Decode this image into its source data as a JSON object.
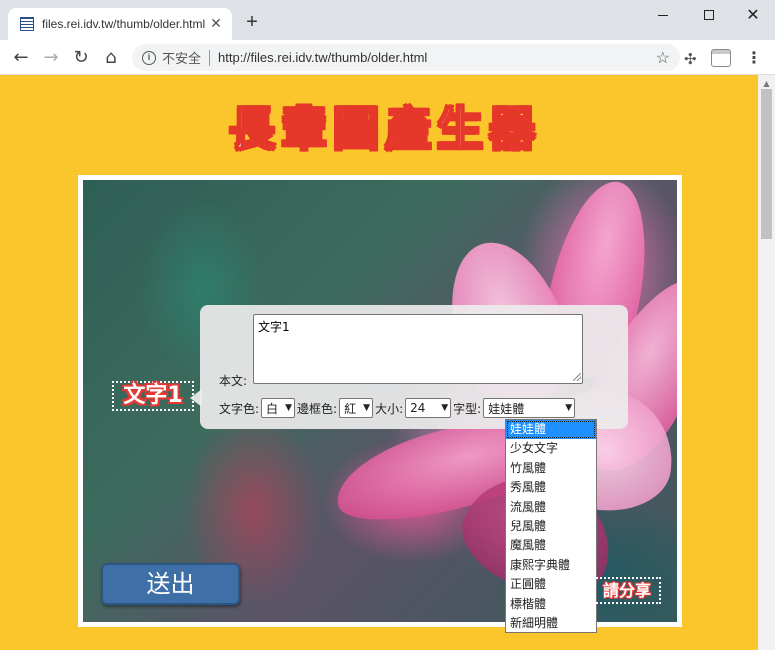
{
  "browser": {
    "tab_title": "files.rei.idv.tw/thumb/older.html",
    "new_tab": "+",
    "insecure_label": "不安全",
    "url": "http://files.rei.idv.tw/thumb/older.html"
  },
  "page": {
    "title": "長輩圖產生器",
    "overlay_text": "文字1",
    "share_text": "請分享",
    "submit_label": "送出",
    "background_color": "#fbc62b",
    "title_color": "#e6372b"
  },
  "editor": {
    "body_label": "本文:",
    "body_value": "文字1",
    "text_color_label": "文字色:",
    "text_color_value": "白",
    "border_color_label": "邊框色:",
    "border_color_value": "紅",
    "size_label": "大小:",
    "size_value": "24",
    "font_label": "字型:",
    "font_value": "娃娃體"
  },
  "font_options": [
    "娃娃體",
    "少女文字",
    "竹風體",
    "秀風體",
    "流風體",
    "兒風體",
    "魔風體",
    "康熙字典體",
    "正圓體",
    "標楷體",
    "新細明體"
  ]
}
